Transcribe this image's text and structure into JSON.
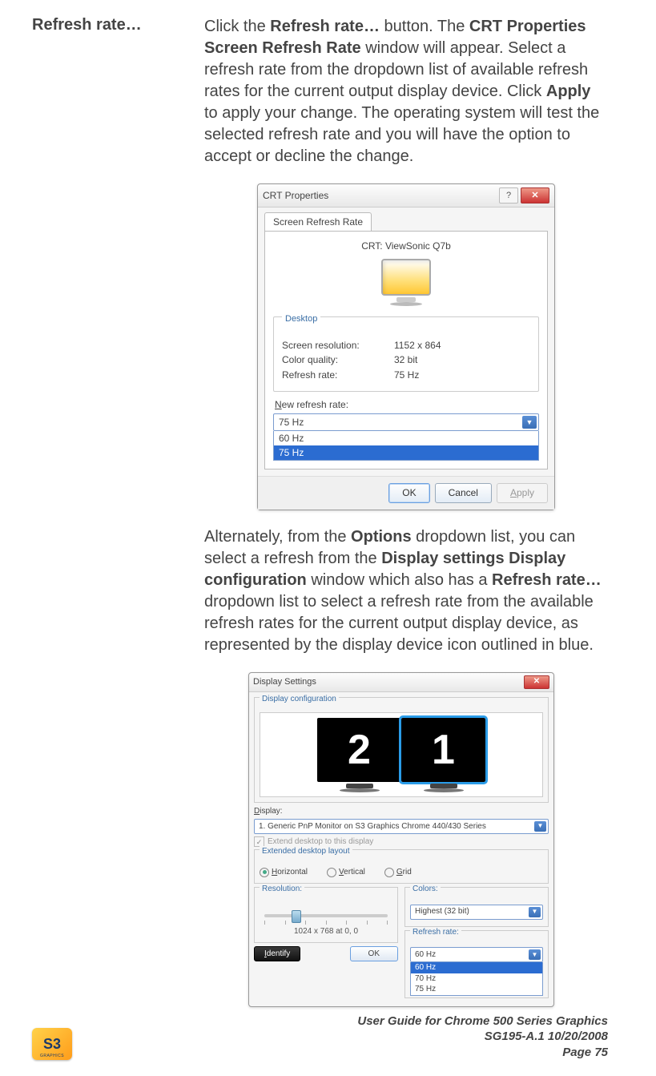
{
  "section": {
    "label": "Refresh rate…",
    "para1_parts": [
      {
        "t": "Click the ",
        "b": false
      },
      {
        "t": "Refresh rate…",
        "b": true
      },
      {
        "t": " button. The ",
        "b": false
      },
      {
        "t": "CRT Properties Screen Refresh Rate",
        "b": true
      },
      {
        "t": " window will appear. Select a refresh rate from the dropdown list of available refresh rates for the current output display device. Click ",
        "b": false
      },
      {
        "t": "Apply",
        "b": true
      },
      {
        "t": " to apply your change. The operating system will test the selected refresh rate and you will have the option to accept or decline the change.",
        "b": false
      }
    ],
    "para2_parts": [
      {
        "t": "Alternately, from the ",
        "b": false
      },
      {
        "t": "Options",
        "b": true
      },
      {
        "t": " dropdown list, you can select a refresh from the ",
        "b": false
      },
      {
        "t": "Display settings Display configuration",
        "b": true
      },
      {
        "t": " window which also has a ",
        "b": false
      },
      {
        "t": "Refresh rate…",
        "b": true
      },
      {
        "t": " dropdown list to select a refresh rate from the available refresh rates for the current output display device, as represented by the display device icon outlined in blue.",
        "b": false
      }
    ]
  },
  "crt_dialog": {
    "title": "CRT Properties",
    "help_glyph": "?",
    "close_glyph": "✕",
    "tab": "Screen Refresh Rate",
    "crt_label": "CRT: ViewSonic Q7b",
    "group_title": "Desktop",
    "rows": {
      "res_k": "Screen resolution:",
      "res_v": "1152 x 864",
      "cq_k": "Color quality:",
      "cq_v": "32 bit",
      "rr_k": "Refresh rate:",
      "rr_v": "75 Hz"
    },
    "new_rate_label_pre": "N",
    "new_rate_label_post": "ew refresh rate:",
    "combo_value": "75 Hz",
    "combo_options": [
      "60 Hz",
      "75 Hz"
    ],
    "combo_selected_index": 1,
    "buttons": {
      "ok": "OK",
      "cancel": "Cancel",
      "apply": "Apply"
    },
    "apply_underline": "A",
    "apply_rest": "pply"
  },
  "ds_dialog": {
    "title": "Display Settings",
    "close_glyph": "✕",
    "group_title": "Display configuration",
    "monitors": [
      "2",
      "1"
    ],
    "active_index": 1,
    "display_label": "Display:",
    "display_underline": "D",
    "display_rest": "isplay:",
    "display_value": "1. Generic PnP Monitor on S3 Graphics Chrome 440/430 Series",
    "extend_chk": "Extend desktop to this display",
    "extend_underline": "E",
    "extend_rest": "xtend desktop to this display",
    "layout_title": "Extended desktop layout",
    "radios": [
      {
        "label": "Horizontal",
        "u": "H",
        "rest": "orizontal",
        "on": true
      },
      {
        "label": "Vertical",
        "u": "V",
        "rest": "ertical",
        "on": false
      },
      {
        "label": "Grid",
        "u": "G",
        "rest": "rid",
        "on": false
      }
    ],
    "res_title": "Resolution:",
    "res_u": "R",
    "res_rest": "esolution:",
    "res_text": "1024 x 768 at 0, 0",
    "colors_title": "Colors:",
    "colors_u": "C",
    "colors_rest": "olors:",
    "colors_value": "Highest (32 bit)",
    "rr_title": "Refresh rate:",
    "rr_value": "60 Hz",
    "rr_options": [
      "60 Hz",
      "70 Hz",
      "75 Hz"
    ],
    "rr_selected_index": 0,
    "identify_btn": "Identify",
    "identify_u": "I",
    "identify_rest": "dentify",
    "ok_btn": "OK"
  },
  "footer": {
    "logo": "S3",
    "logo_sub": "GRAPHICS",
    "line1": "User Guide for Chrome 500 Series Graphics",
    "line2": "SG195-A.1   10/20/2008",
    "page_label": "Page ",
    "page_num": "75"
  }
}
